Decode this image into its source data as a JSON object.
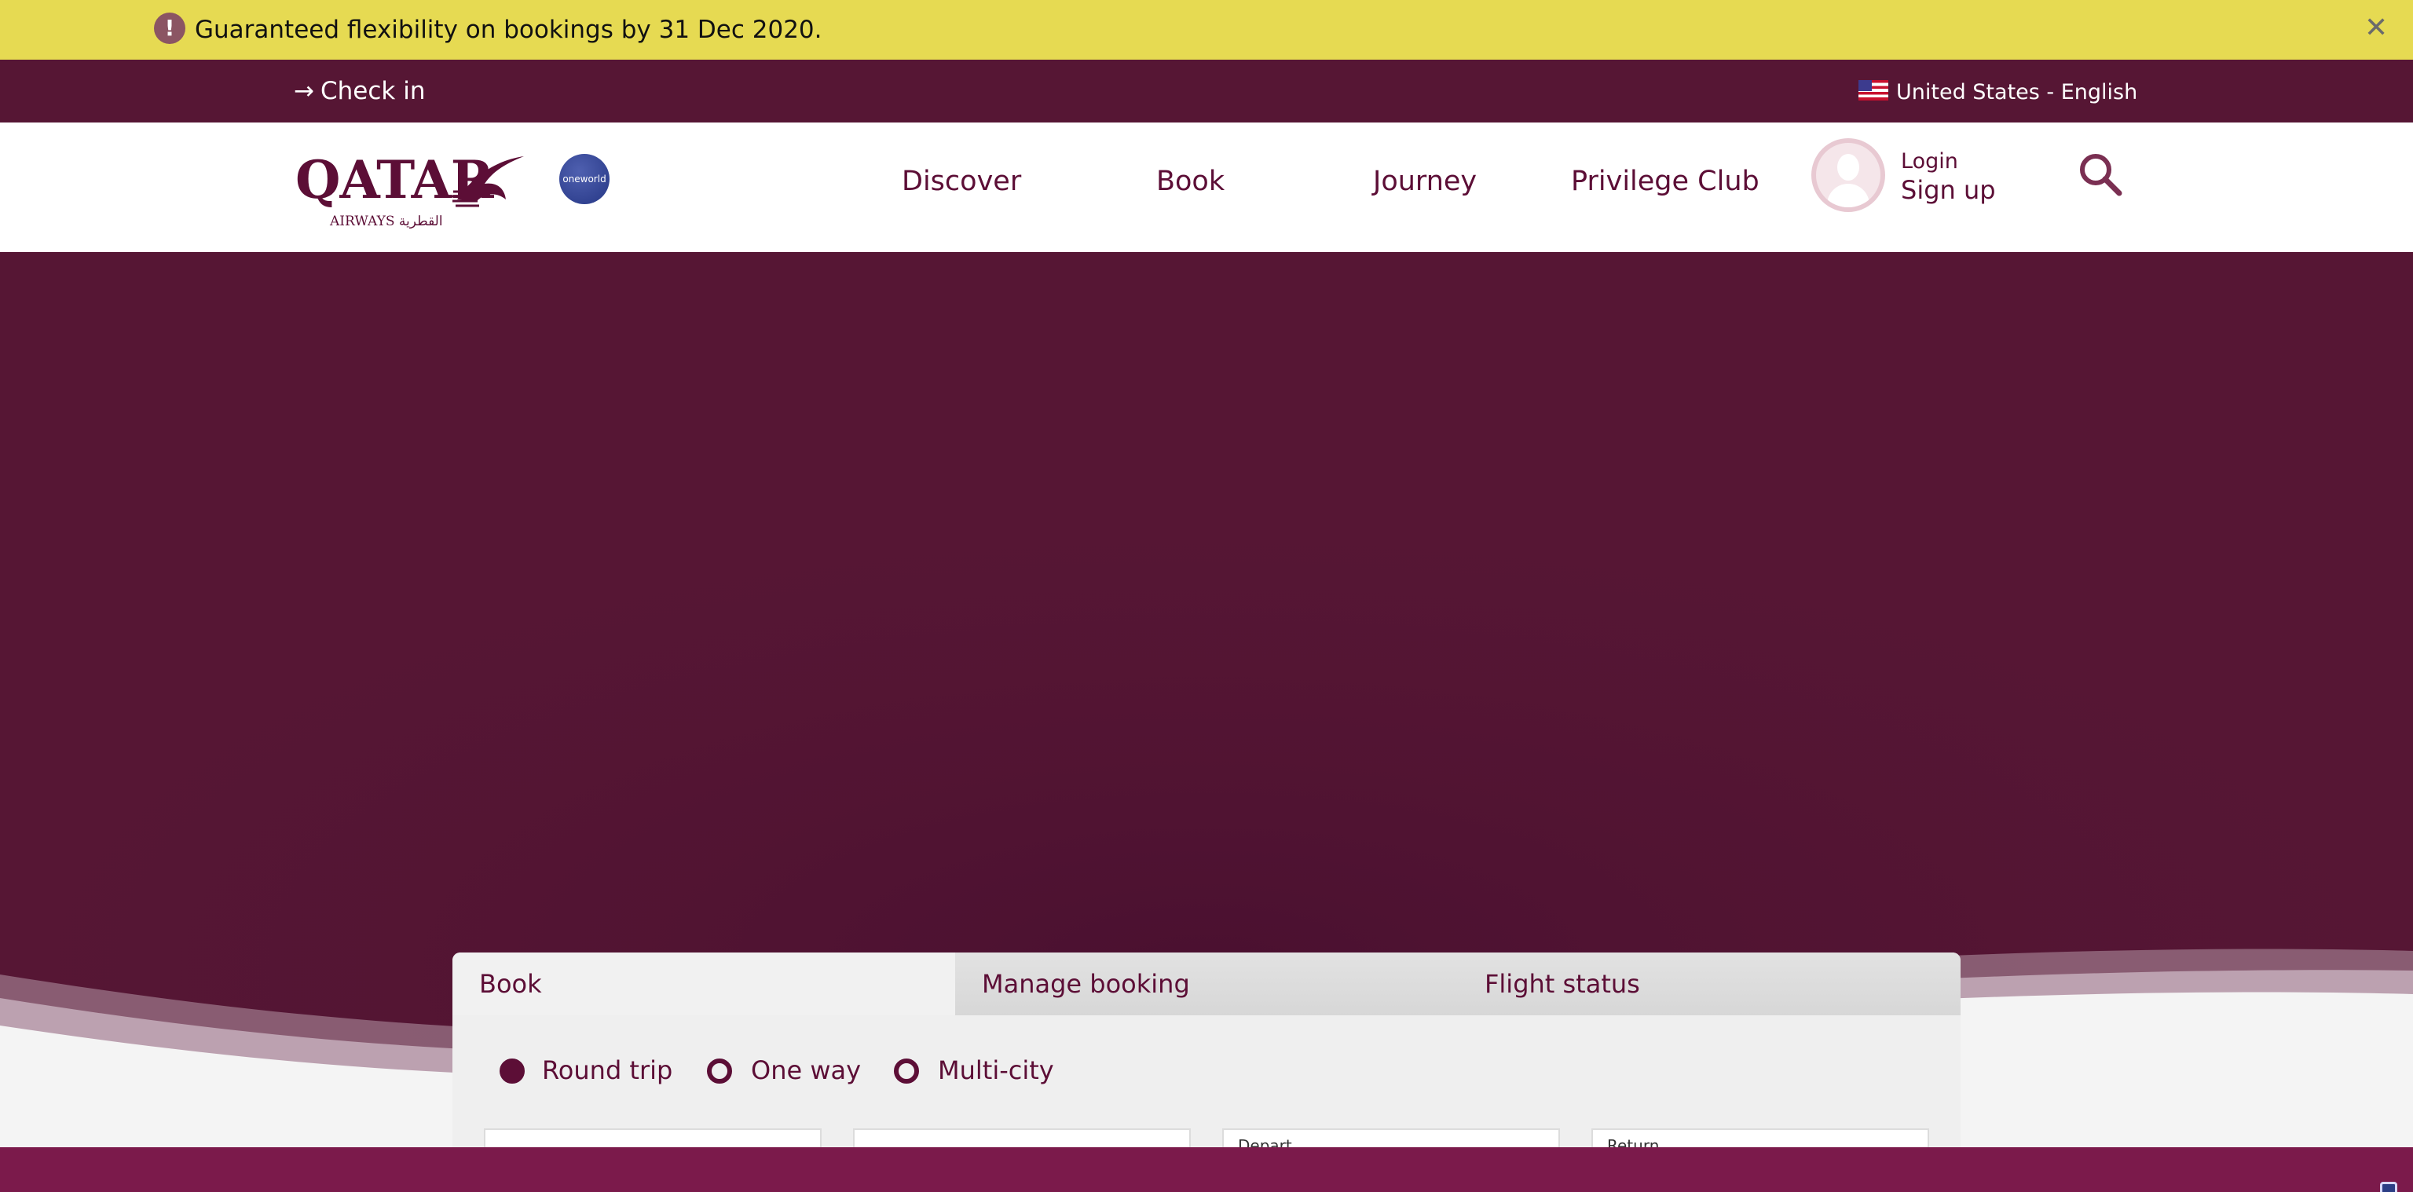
{
  "alert": {
    "icon": "exclamation-icon",
    "icon_glyph": "!",
    "text": "Guaranteed flexibility on bookings by 31 Dec 2020.",
    "close_glyph": "✕"
  },
  "utility": {
    "checkin_arrow": "→",
    "checkin": "Check in",
    "locale": "United States - English"
  },
  "brand": {
    "word": "QATAR",
    "sub": "AIRWAYS القطرية",
    "alliance": "oneworld"
  },
  "nav": {
    "items": [
      {
        "label": "Discover"
      },
      {
        "label": "Book"
      },
      {
        "label": "Journey"
      },
      {
        "label": "Privilege Club"
      }
    ],
    "login": "Login",
    "signup": "Sign up"
  },
  "widget": {
    "tabs": [
      {
        "label": "Book"
      },
      {
        "label": "Manage booking"
      },
      {
        "label": "Flight status"
      }
    ],
    "trip_types": [
      {
        "label": "Round trip",
        "selected": true
      },
      {
        "label": "One way",
        "selected": false
      },
      {
        "label": "Multi-city",
        "selected": false
      }
    ],
    "fields": [
      {
        "label": ""
      },
      {
        "label": ""
      },
      {
        "label": "Depart"
      },
      {
        "label": "Return"
      }
    ]
  },
  "colors": {
    "brand_maroon": "#5c0e36",
    "hero": "#561634",
    "alert": "#e6da52",
    "bottom": "#7b1a4b"
  }
}
